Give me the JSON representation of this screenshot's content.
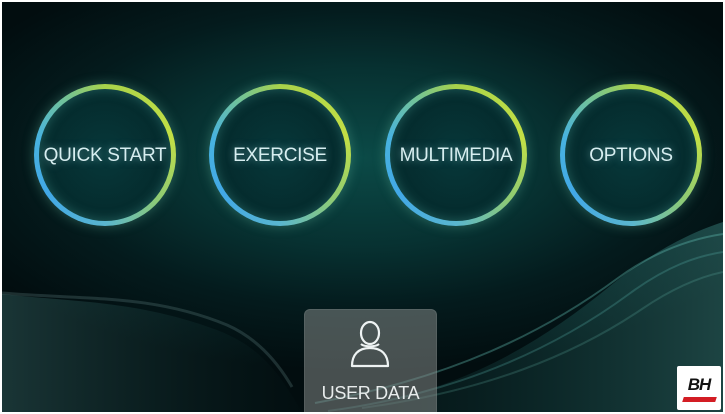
{
  "menu": {
    "items": [
      {
        "label": "QUICK START"
      },
      {
        "label": "EXERCISE"
      },
      {
        "label": "MULTIMEDIA"
      },
      {
        "label": "OPTIONS"
      }
    ]
  },
  "user_panel": {
    "label": "USER DATA",
    "icon": "user-icon"
  },
  "brand": {
    "text": "BH",
    "icon": "bh-logo",
    "colors": {
      "text": "#111111",
      "accent": "#d31d24"
    }
  },
  "theme": {
    "background": "#073131",
    "ring_green": "#a9d24a",
    "ring_blue": "#42a8e6",
    "label_color": "#d7eef0"
  }
}
